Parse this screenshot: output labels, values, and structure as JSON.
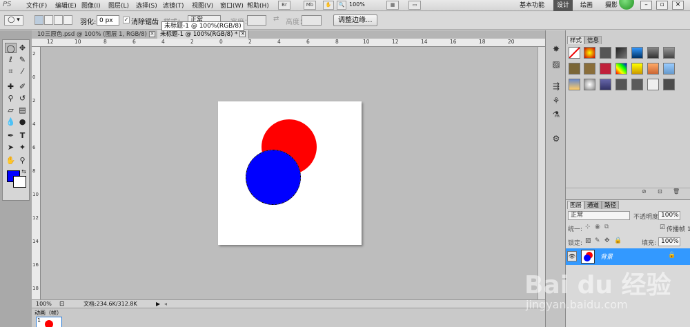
{
  "menubar": {
    "logo": "PS",
    "items": [
      "文件(F)",
      "编辑(E)",
      "图像(I)",
      "图层(L)",
      "选择(S)",
      "滤镜(T)",
      "视图(V)",
      "窗口(W)",
      "帮助(H)"
    ],
    "br_label": "Br",
    "mb_label": "Mb",
    "zoom": "100%",
    "workspaces": [
      "基本功能",
      "设计",
      "绘画",
      "摄影"
    ]
  },
  "options": {
    "feather_label": "羽化:",
    "feather_value": "0 px",
    "antialias_label": "消除锯齿",
    "style_label": "样式：",
    "style_value": "正常",
    "width_label": "宽度：",
    "height_label": "高度：",
    "refine_button": "调整边缘..."
  },
  "tooltip": "未标题-1 @ 100%(RGB/8)",
  "tabs": [
    {
      "label": "10三原色.psd @ 100% (图层 1, RGB/8)"
    },
    {
      "label": "未标题-1 @ 100%(RGB/8) *"
    }
  ],
  "ruler_top": [
    "12",
    "10",
    "8",
    "6",
    "4",
    "2",
    "0",
    "2",
    "4",
    "6",
    "8",
    "10",
    "12",
    "14",
    "16",
    "18",
    "20"
  ],
  "ruler_left": [
    "2",
    "0",
    "2",
    "4",
    "6",
    "8",
    "10",
    "12",
    "14",
    "16",
    "18"
  ],
  "status": {
    "zoom": "100%",
    "doc_info": "文档:234.6K/312.8K"
  },
  "animation": {
    "title": "动画（帧）",
    "frame_number": "1"
  },
  "styles_panel": {
    "tabs": [
      "样式",
      "信息"
    ]
  },
  "layers_panel": {
    "tabs": [
      "图层",
      "通道",
      "路径"
    ],
    "blend_mode": "正常",
    "opacity_label": "不透明度:",
    "opacity_value": "100%",
    "unify_label": "统一:",
    "propagate_label": "传播帧 1",
    "lock_label": "锁定:",
    "fill_label": "填充:",
    "fill_value": "100%",
    "layer_name": "背景"
  },
  "colors": {
    "foreground": "#0000ff",
    "background": "#ffffff",
    "red_circle": "#ff0000",
    "blue_circle": "#0000ff",
    "selected_layer": "#3399ff"
  },
  "watermark": {
    "brand": "Bai du 经验",
    "url": "jingyan.baidu.com"
  }
}
